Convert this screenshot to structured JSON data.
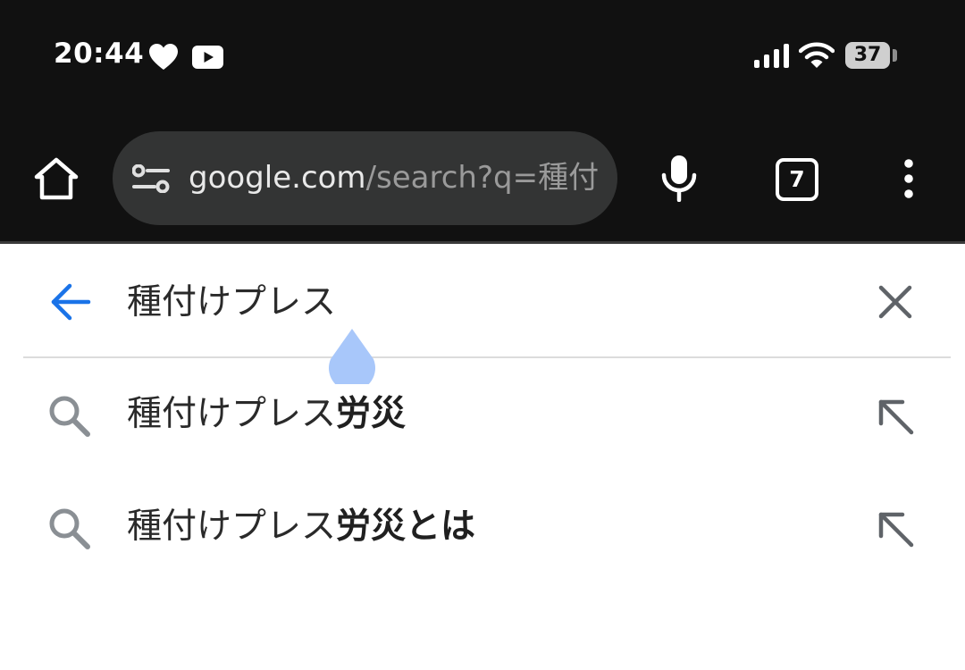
{
  "status_bar": {
    "time": "20:44",
    "icons": [
      "heart-icon",
      "youtube-icon"
    ],
    "right_icons": [
      "signal-icon",
      "wifi-icon",
      "battery-icon"
    ],
    "battery": "37"
  },
  "toolbar": {
    "home_icon": "home-icon",
    "site_settings_icon": "tune-icon",
    "url_host": "google.com",
    "url_path": "/search?q=種付け",
    "mic_icon": "mic-icon",
    "tab_count": "7",
    "menu_icon": "more-vert-icon"
  },
  "search": {
    "query": "種付けプレス",
    "back_icon": "arrow-back-icon",
    "clear_icon": "close-icon",
    "accent": "#1a73e8"
  },
  "suggestions": [
    {
      "prefix": "種付けプレス",
      "completion": "労災"
    },
    {
      "prefix": "種付けプレス",
      "completion": "労災とは"
    }
  ],
  "colors": {
    "dark_bg": "#111111",
    "urlbar_bg": "#333434",
    "cursor_handle": "#a8c7fa"
  }
}
